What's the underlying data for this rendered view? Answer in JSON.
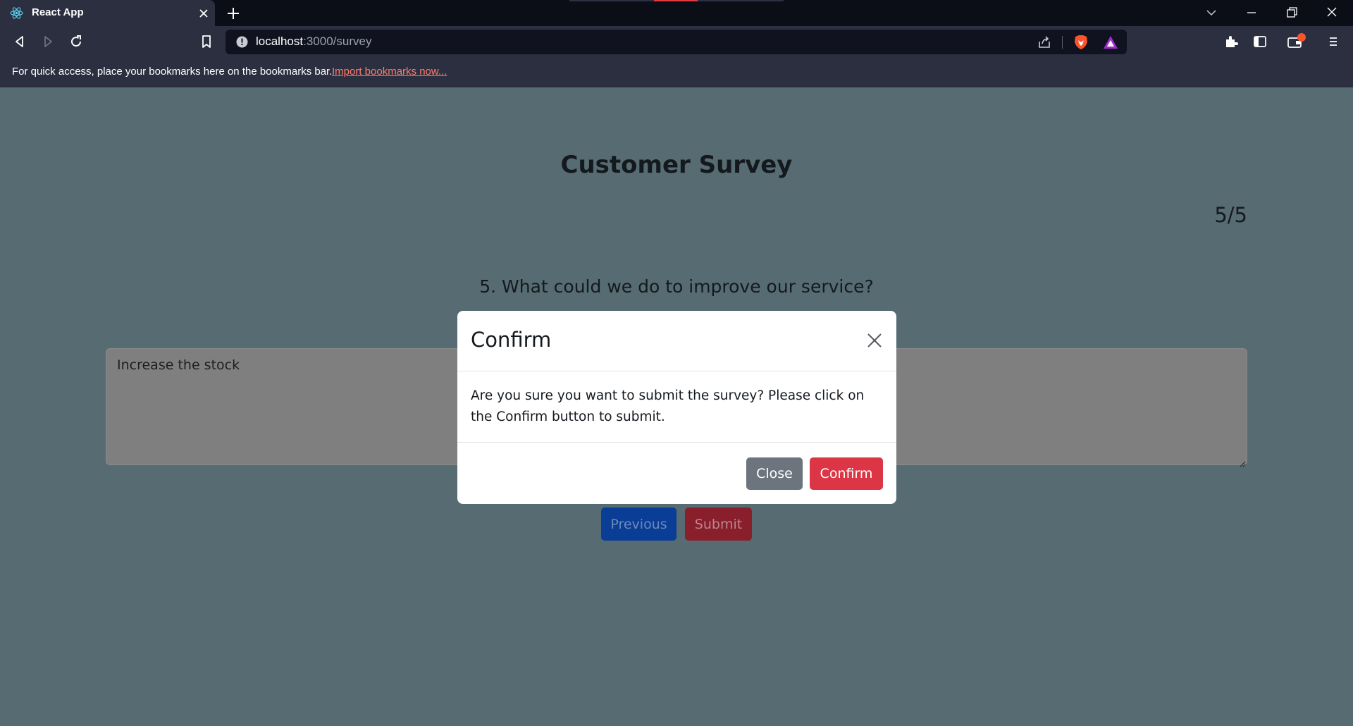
{
  "browser": {
    "tab": {
      "title": "React App",
      "favicon": "react-icon"
    },
    "address": {
      "host": "localhost",
      "path": ":3000/survey"
    },
    "bookmarks_bar": {
      "text": "For quick access, place your bookmarks here on the bookmarks bar.",
      "link": "Import bookmarks now..."
    },
    "colors": {
      "tabstrip": "#0b0d17",
      "toolbar": "#2b2f40",
      "omnibox": "#10131f"
    }
  },
  "survey": {
    "title": "Customer Survey",
    "progress": "5/5",
    "question": "5. What could we do to improve our service?",
    "answer": "Increase the stock",
    "buttons": {
      "previous": "Previous",
      "submit": "Submit"
    }
  },
  "modal": {
    "title": "Confirm",
    "body": "Are you sure you want to submit the survey? Please click on the Confirm button to submit.",
    "buttons": {
      "close": "Close",
      "confirm": "Confirm"
    },
    "colors": {
      "close": "#6c757d",
      "confirm": "#dc3545"
    }
  }
}
